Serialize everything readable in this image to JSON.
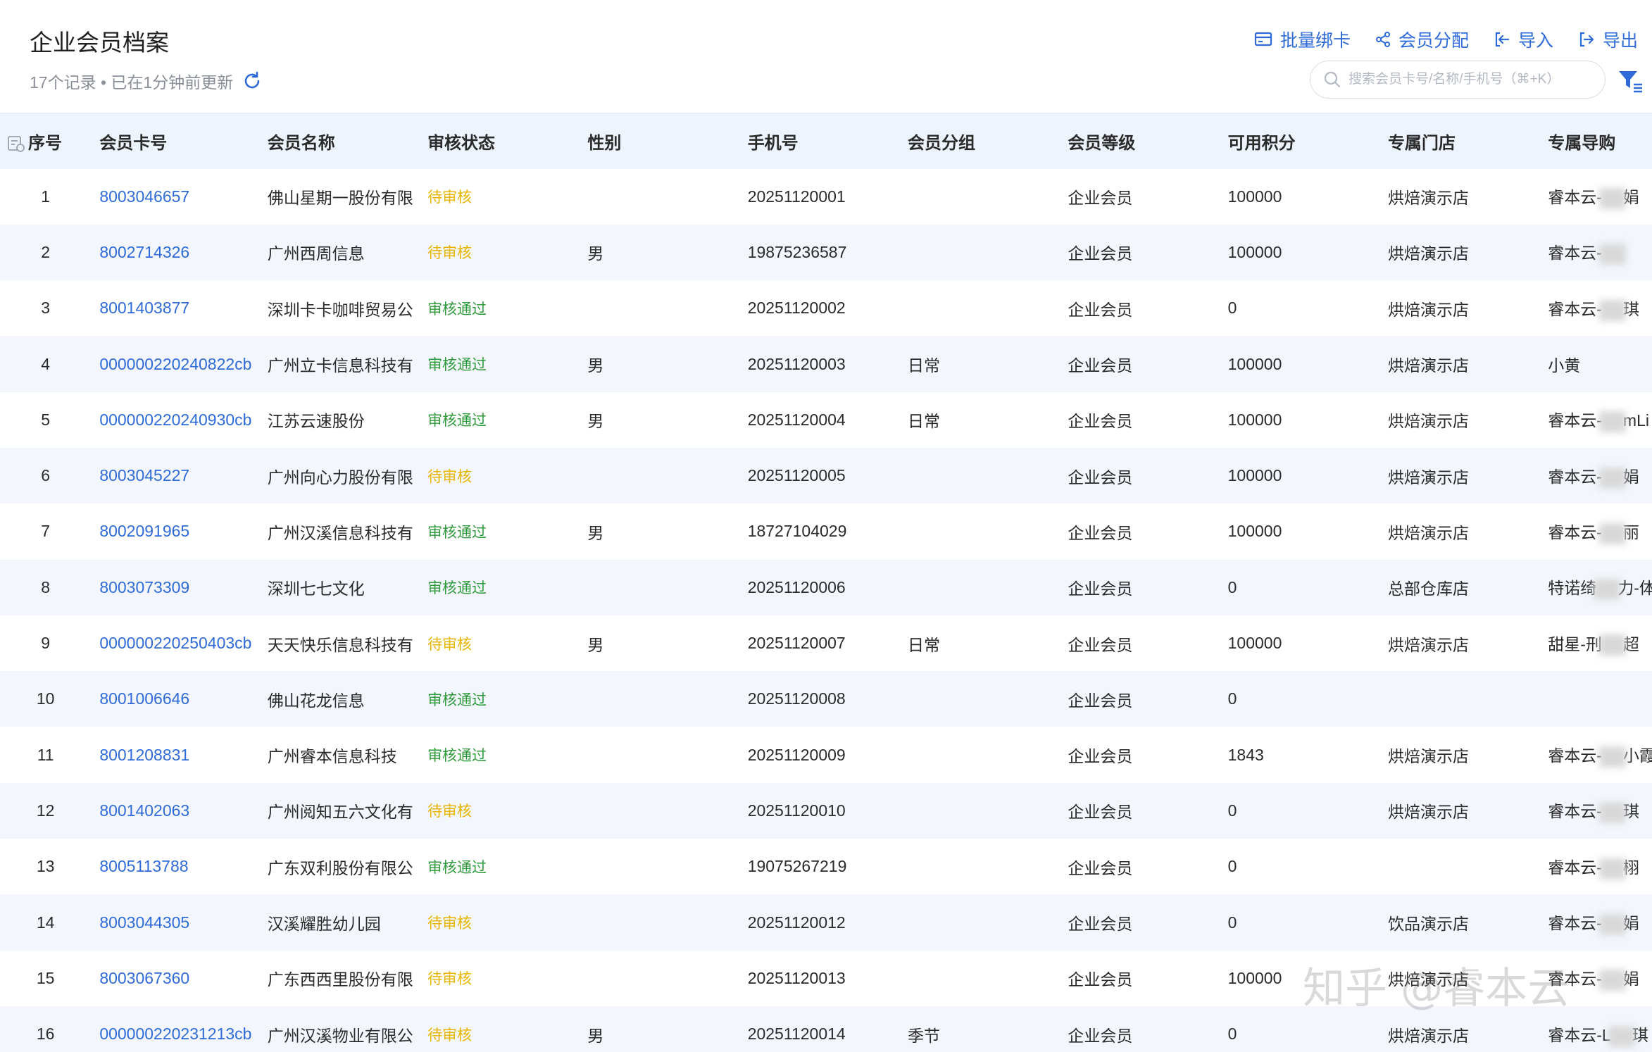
{
  "header": {
    "title": "企业会员档案",
    "subtitle": "17个记录 • 已在1分钟前更新",
    "actions": {
      "batch_bind": "批量绑卡",
      "assign": "会员分配",
      "import": "导入",
      "export": "导出"
    },
    "search": {
      "placeholder": "搜索会员卡号/名称/手机号（⌘+K）",
      "value": ""
    }
  },
  "colors": {
    "accent": "#2f6bd8",
    "pending": "#e8b400",
    "approved": "#2f9a3c",
    "header_bg": "#eef4fd"
  },
  "table": {
    "columns": [
      "序号",
      "会员卡号",
      "会员名称",
      "审核状态",
      "性别",
      "手机号",
      "会员分组",
      "会员等级",
      "可用积分",
      "专属门店",
      "专属导购"
    ],
    "rows": [
      {
        "idx": "1",
        "card": "8003046657",
        "name": "佛山星期一股份有限",
        "status": "待审核",
        "gender": "",
        "phone": "20251120001",
        "group": "",
        "level": "企业会员",
        "points": "100000",
        "store": "烘焙演示店",
        "guide_pre": "睿本云-",
        "guide_post": "娟"
      },
      {
        "idx": "2",
        "card": "8002714326",
        "name": "广州西周信息",
        "status": "待审核",
        "gender": "男",
        "phone": "19875236587",
        "group": "",
        "level": "企业会员",
        "points": "100000",
        "store": "烘焙演示店",
        "guide_pre": "睿本云-",
        "guide_post": ""
      },
      {
        "idx": "3",
        "card": "8001403877",
        "name": "深圳卡卡咖啡贸易公",
        "status": "审核通过",
        "gender": "",
        "phone": "20251120002",
        "group": "",
        "level": "企业会员",
        "points": "0",
        "store": "烘焙演示店",
        "guide_pre": "睿本云-",
        "guide_post": "琪"
      },
      {
        "idx": "4",
        "card": "000000220240822cb",
        "name": "广州立卡信息科技有",
        "status": "审核通过",
        "gender": "男",
        "phone": "20251120003",
        "group": "日常",
        "level": "企业会员",
        "points": "100000",
        "store": "烘焙演示店",
        "guide_pre": "小黄",
        "guide_post": ""
      },
      {
        "idx": "5",
        "card": "000000220240930cb",
        "name": "江苏云速股份",
        "status": "审核通过",
        "gender": "男",
        "phone": "20251120004",
        "group": "日常",
        "level": "企业会员",
        "points": "100000",
        "store": "烘焙演示店",
        "guide_pre": "睿本云-",
        "guide_post": "mLi"
      },
      {
        "idx": "6",
        "card": "8003045227",
        "name": "广州向心力股份有限",
        "status": "待审核",
        "gender": "",
        "phone": "20251120005",
        "group": "",
        "level": "企业会员",
        "points": "100000",
        "store": "烘焙演示店",
        "guide_pre": "睿本云-",
        "guide_post": "娟"
      },
      {
        "idx": "7",
        "card": "8002091965",
        "name": "广州汉溪信息科技有",
        "status": "审核通过",
        "gender": "男",
        "phone": "18727104029",
        "group": "",
        "level": "企业会员",
        "points": "100000",
        "store": "烘焙演示店",
        "guide_pre": "睿本云-",
        "guide_post": "丽"
      },
      {
        "idx": "8",
        "card": "8003073309",
        "name": "深圳七七文化",
        "status": "审核通过",
        "gender": "",
        "phone": "20251120006",
        "group": "",
        "level": "企业会员",
        "points": "0",
        "store": "总部仓库店",
        "guide_pre": "特诺绮",
        "guide_post": "力-体"
      },
      {
        "idx": "9",
        "card": "000000220250403cb",
        "name": "天天快乐信息科技有",
        "status": "待审核",
        "gender": "男",
        "phone": "20251120007",
        "group": "日常",
        "level": "企业会员",
        "points": "100000",
        "store": "烘焙演示店",
        "guide_pre": "甜星-刑",
        "guide_post": "超"
      },
      {
        "idx": "10",
        "card": "8001006646",
        "name": "佛山花龙信息",
        "status": "审核通过",
        "gender": "",
        "phone": "20251120008",
        "group": "",
        "level": "企业会员",
        "points": "0",
        "store": "",
        "guide_pre": "",
        "guide_post": ""
      },
      {
        "idx": "11",
        "card": "8001208831",
        "name": "广州睿本信息科技",
        "status": "审核通过",
        "gender": "",
        "phone": "20251120009",
        "group": "",
        "level": "企业会员",
        "points": "1843",
        "store": "烘焙演示店",
        "guide_pre": "睿本云-",
        "guide_post": "小霞"
      },
      {
        "idx": "12",
        "card": "8001402063",
        "name": "广州阅知五六文化有",
        "status": "待审核",
        "gender": "",
        "phone": "20251120010",
        "group": "",
        "level": "企业会员",
        "points": "0",
        "store": "烘焙演示店",
        "guide_pre": "睿本云-",
        "guide_post": "琪"
      },
      {
        "idx": "13",
        "card": "8005113788",
        "name": "广东双利股份有限公",
        "status": "审核通过",
        "gender": "",
        "phone": "19075267219",
        "group": "",
        "level": "企业会员",
        "points": "0",
        "store": "",
        "guide_pre": "睿本云-",
        "guide_post": "栩"
      },
      {
        "idx": "14",
        "card": "8003044305",
        "name": "汉溪耀胜幼儿园",
        "status": "待审核",
        "gender": "",
        "phone": "20251120012",
        "group": "",
        "level": "企业会员",
        "points": "0",
        "store": "饮品演示店",
        "guide_pre": "睿本云-",
        "guide_post": "娟"
      },
      {
        "idx": "15",
        "card": "8003067360",
        "name": "广东西西里股份有限",
        "status": "待审核",
        "gender": "",
        "phone": "20251120013",
        "group": "",
        "level": "企业会员",
        "points": "100000",
        "store": "烘焙演示店",
        "guide_pre": "睿本云-",
        "guide_post": "娟"
      },
      {
        "idx": "16",
        "card": "000000220231213cb",
        "name": "广州汉溪物业有限公",
        "status": "待审核",
        "gender": "男",
        "phone": "20251120014",
        "group": "季节",
        "level": "企业会员",
        "points": "0",
        "store": "烘焙演示店",
        "guide_pre": "睿本云-L",
        "guide_post": "琪"
      }
    ]
  },
  "watermark": "知乎 @睿本云"
}
